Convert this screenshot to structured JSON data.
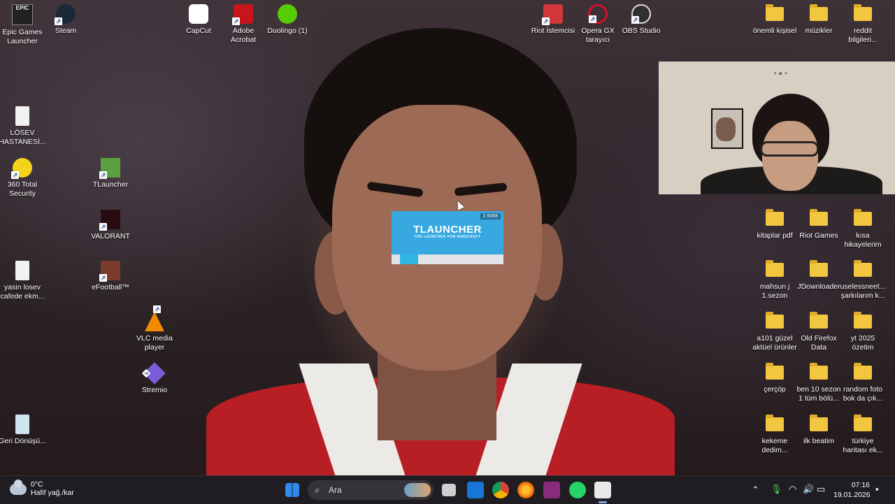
{
  "desktop": {
    "left_icons": [
      {
        "name": "epic-games-launcher-icon",
        "label": "Epic Games Launcher"
      },
      {
        "name": "steam-icon",
        "label": "Steam"
      },
      {
        "name": "losev-file-icon",
        "label": "LÖSEV HASTANESİ..."
      },
      {
        "name": "360-total-security-icon",
        "label": "360 Total Security"
      },
      {
        "name": "tlauncher-icon",
        "label": "TLauncher"
      },
      {
        "name": "valorant-icon",
        "label": "VALORANT"
      },
      {
        "name": "yasin-losev-file-icon",
        "label": "yasin losev cafede ekm..."
      },
      {
        "name": "efootball-icon",
        "label": "eFootball™"
      },
      {
        "name": "vlc-icon",
        "label": "VLC media player"
      },
      {
        "name": "stremio-icon",
        "label": "Stremio"
      },
      {
        "name": "recycle-bin-icon",
        "label": "Geri Dönüşü..."
      }
    ],
    "top_icons": [
      {
        "name": "capcut-icon",
        "label": "CapCut"
      },
      {
        "name": "adobe-acrobat-icon",
        "label": "Adobe Acrobat"
      },
      {
        "name": "duolingo-icon",
        "label": "Duolingo (1)"
      },
      {
        "name": "riot-client-icon",
        "label": "Riot İstemcisi"
      },
      {
        "name": "opera-gx-icon",
        "label": "Opera GX tarayıcı"
      },
      {
        "name": "obs-studio-icon",
        "label": "OBS Studio"
      }
    ],
    "folders": [
      "önemli kişisel",
      "müzikler",
      "reddit bilgileri...",
      "kitaplar pdf",
      "Riot Games",
      "kısa hikayelerim",
      "mahsun j 1.sezon",
      "JDownloader",
      "uselessneet... şarkılarım k...",
      "a101 güzel aktüel ürünler",
      "Old Firefox Data",
      "yt 2025 özetim",
      "çerçöp",
      "ben 10 sezon 1 tüm bölü...",
      "random foto bok da çık...",
      "kekeme dedim...",
      "ilk beatim",
      "türkiye haritası ek..."
    ]
  },
  "splash": {
    "version": "2.9358",
    "title": "TLAUNCHER",
    "subtitle": "THE LAUNCHER FOR MINECRAFT",
    "progress": 0.16
  },
  "taskbar": {
    "weather_temp": "0°C",
    "weather_desc": "Hafif yağ./kar",
    "search_placeholder": "Ara",
    "time": "07:16",
    "date": "19.01.2026",
    "pinned": [
      "windows-start-icon",
      "task-view-icon",
      "outlook-icon",
      "chrome-icon",
      "firefox-icon",
      "app-icon",
      "whatsapp-icon",
      "java-icon"
    ]
  },
  "colors": {
    "folder": "#f3c640",
    "taskbar": "#1f1c22",
    "splash_bg": "#38a8e0",
    "splash_progress": "#2fb6e5"
  }
}
